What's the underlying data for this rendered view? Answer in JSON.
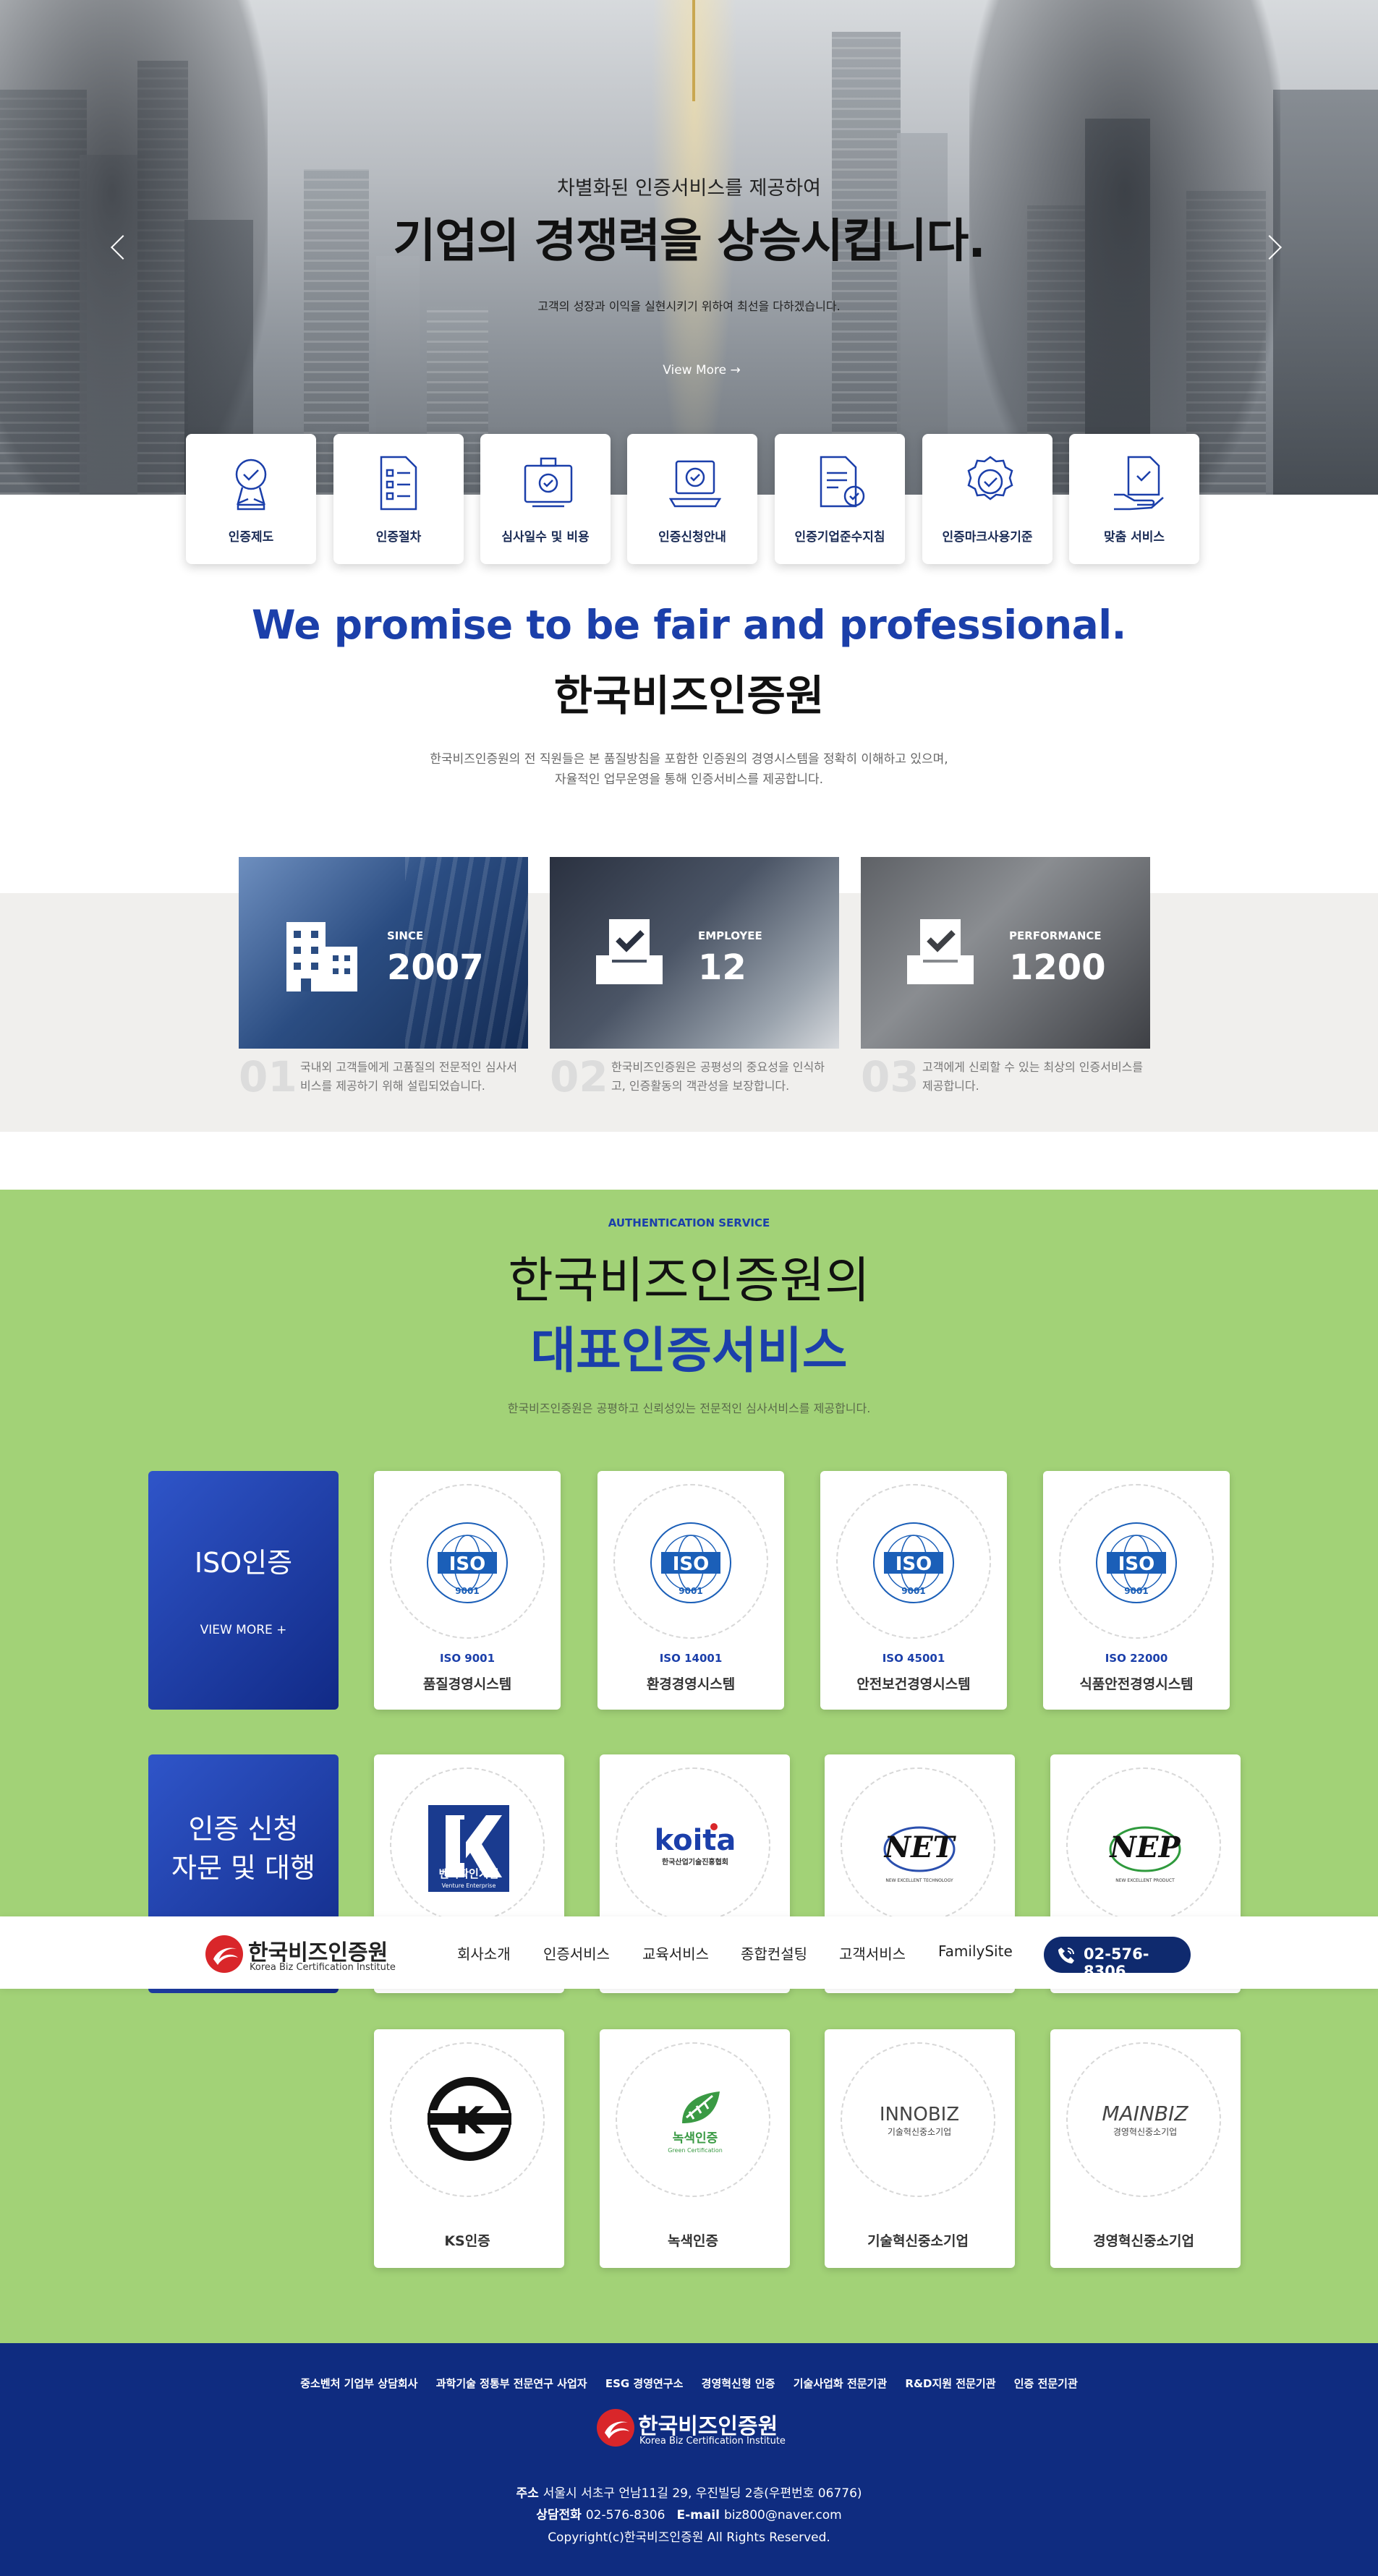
{
  "hero": {
    "subtitle": "차별화된 인증서비스를 제공하여",
    "title": "기업의 경쟁력을 상승시킵니다.",
    "description": "고객의 성장과 이익을 실현시키기 위하여 최선을 다하겠습니다.",
    "view_more": "View More →"
  },
  "quick_menu": [
    {
      "label": "인증제도",
      "icon": "award-badge-icon"
    },
    {
      "label": "인증절차",
      "icon": "checklist-document-icon"
    },
    {
      "label": "심사일수 및 비용",
      "icon": "certificate-board-icon"
    },
    {
      "label": "인증신청안내",
      "icon": "laptop-check-icon"
    },
    {
      "label": "인증기업준수지침",
      "icon": "document-check-icon"
    },
    {
      "label": "인증마크사용기준",
      "icon": "seal-check-icon"
    },
    {
      "label": "맞춤 서비스",
      "icon": "hand-document-icon"
    }
  ],
  "promise": {
    "english": "We promise to be fair and professional.",
    "korean": "한국비즈인증원",
    "desc_line1": "한국비즈인증원의 전 직원들은 본 품질방침을 포함한 인증원의 경영시스템을 정확히 이해하고 있으며,",
    "desc_line2": "자율적인 업무운영을 통해 인증서비스를 제공합니다."
  },
  "stats": [
    {
      "label": "SINCE",
      "value": "2007",
      "index": "01",
      "text": "국내외 고객들에게 고품질의 전문적인 심사서비스를 제공하기 위해 설립되었습니다.",
      "icon": "building-icon"
    },
    {
      "label": "EMPLOYEE",
      "value": "12",
      "index": "02",
      "text": "한국비즈인증원은 공평성의 중요성을 인식하고, 인증활동의 객관성을 보장합니다.",
      "icon": "inbox-check-icon"
    },
    {
      "label": "PERFORMANCE",
      "value": "1200",
      "index": "03",
      "text": "고객에게 신뢰할 수 있는 최상의 인증서비스를 제공합니다.",
      "icon": "inbox-check-icon"
    }
  ],
  "service": {
    "tag": "AUTHENTICATION SERVICE",
    "title1": "한국비즈인증원의",
    "title2": "대표인증서비스",
    "description": "한국비즈인증원은 공평하고 신뢰성있는 전문적인 심사서비스를 제공합니다."
  },
  "iso_block": {
    "title": "ISO인증",
    "more": "VIEW MORE +",
    "certs": [
      {
        "code": "ISO 9001",
        "name": "품질경영시스템",
        "badge": "9001"
      },
      {
        "code": "ISO 14001",
        "name": "환경경영시스템",
        "badge": "9001"
      },
      {
        "code": "ISO 45001",
        "name": "안전보건경영시스템",
        "badge": "9001"
      },
      {
        "code": "ISO 22000",
        "name": "식품안전경영시스템",
        "badge": "9001"
      }
    ]
  },
  "apply_block": {
    "line1": "인증 신청",
    "line2": "자문 및 대행",
    "certs_row1": [
      {
        "name": "벤처확인기업",
        "logo_sub": "Venture Enterprise"
      },
      {
        "name": "koita",
        "logo_sub": "한국산업기술진흥협회"
      },
      {
        "name": "NET",
        "logo_sub": "NEW EXCELLENT TECHNOLOGY"
      },
      {
        "name": "NEP",
        "logo_sub": "NEW EXCELLENT PRODUCT"
      }
    ],
    "certs_row2": [
      {
        "name": "KS인증"
      },
      {
        "name": "녹색인증",
        "logo_text": "녹색인증",
        "logo_sub": "Green Certification"
      },
      {
        "name": "기술혁신중소기업",
        "logo_text": "INNOBIZ",
        "logo_sub": "기술혁신중소기업"
      },
      {
        "name": "경영혁신중소기업",
        "logo_text": "MAINBIZ",
        "logo_sub": "경영혁신중소기업"
      }
    ]
  },
  "nav": {
    "logo_ko": "한국비즈인증원",
    "logo_en": "Korea Biz Certification Institute",
    "items": [
      "회사소개",
      "인증서비스",
      "교육서비스",
      "종합컨설팅",
      "고객서비스",
      "FamilySite"
    ],
    "phone": "02-576-8306"
  },
  "footer": {
    "links": [
      "중소벤처 기업부 상담회사",
      "과학기술 정통부 전문연구 사업자",
      "ESG 경영연구소",
      "경영혁신형 인증",
      "기술사업화 전문기관",
      "R&D지원 전문기관",
      "인증 전문기관"
    ],
    "logo_ko": "한국비즈인증원",
    "logo_en": "Korea Biz Certification Institute",
    "address_label": "주소",
    "address": "서울시 서초구 언남11길 29, 우진빌딩 2층(우편번호 06776)",
    "phone_label": "상담전화",
    "phone": "02-576-8306",
    "email_label": "E-mail",
    "email": "biz800@naver.com",
    "copyright": "Copyright(c)한국비즈인증원 All Rights Reserved."
  },
  "colors": {
    "brand_blue": "#1b3faa",
    "green_bg": "#a2d277",
    "footer_navy": "#0f2c80"
  }
}
